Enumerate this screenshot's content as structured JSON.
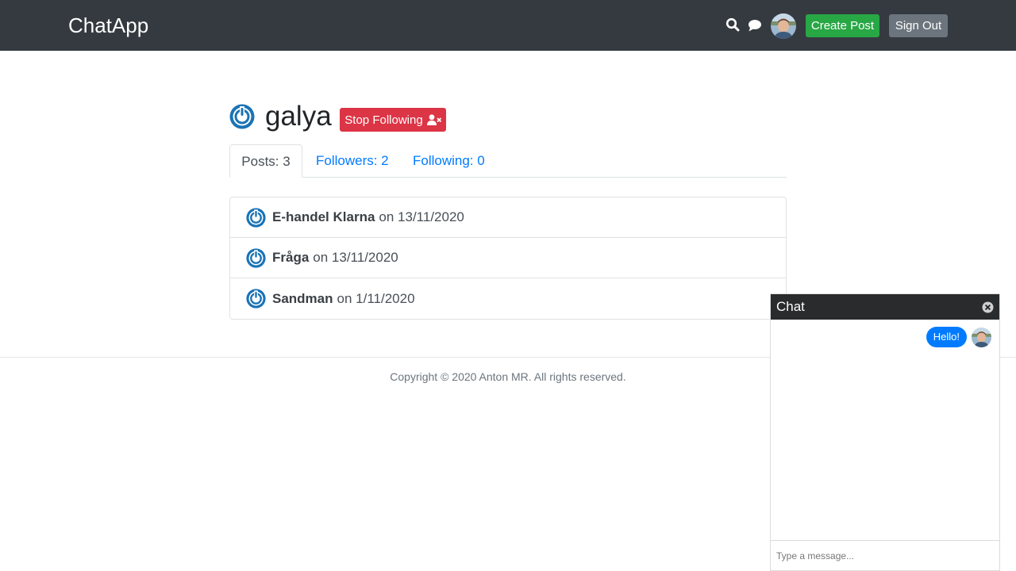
{
  "header": {
    "brand": "ChatApp",
    "create_post_label": "Create Post",
    "sign_out_label": "Sign Out"
  },
  "profile": {
    "username": "galya",
    "stop_following_label": "Stop Following"
  },
  "tabs": [
    {
      "label": "Posts: 3",
      "active": true
    },
    {
      "label": "Followers: 2",
      "active": false
    },
    {
      "label": "Following: 0",
      "active": false
    }
  ],
  "posts": [
    {
      "title": "E-handel Klarna",
      "date_text": "on 13/11/2020"
    },
    {
      "title": "Fråga",
      "date_text": "on 13/11/2020"
    },
    {
      "title": "Sandman",
      "date_text": "on 1/11/2020"
    }
  ],
  "footer": {
    "copyright": "Copyright © 2020 Anton MR. All rights reserved."
  },
  "chat": {
    "title": "Chat",
    "messages": [
      {
        "text": "Hello!",
        "from_self": true
      }
    ],
    "input_placeholder": "Type a message..."
  },
  "colors": {
    "navbar": "#343a40",
    "create_post": "#28a745",
    "sign_out": "#6c757d",
    "stop_following": "#dc3545",
    "link": "#007bff",
    "chat_bubble": "#007bff",
    "avatar_ring": "#1a73b5"
  },
  "icons": {
    "search": "search-icon",
    "chat": "chat-icon",
    "stop_following": "user-times-icon",
    "close": "close-icon",
    "avatar_placeholder": "power-avatar-icon"
  }
}
